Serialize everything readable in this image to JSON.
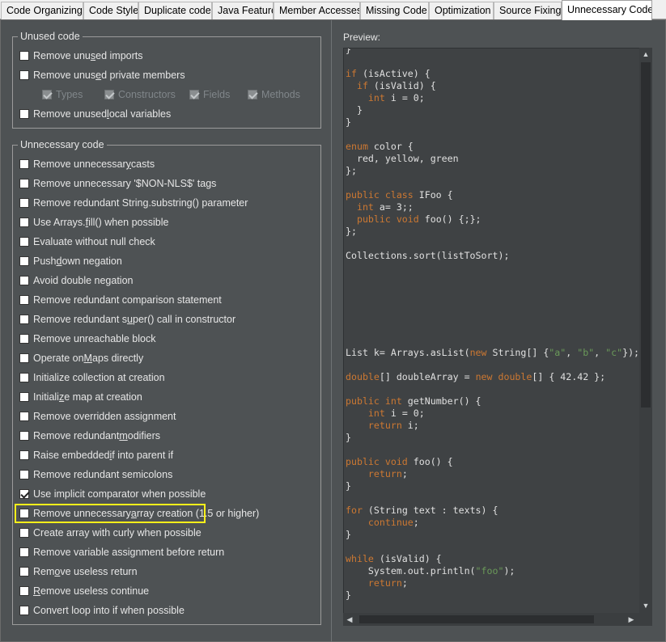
{
  "tabs": [
    {
      "label": "Code Organizing",
      "active": false
    },
    {
      "label": "Code Style",
      "active": false
    },
    {
      "label": "Duplicate code",
      "active": false
    },
    {
      "label": "Java Feature",
      "active": false
    },
    {
      "label": "Member Accesses",
      "active": false
    },
    {
      "label": "Missing Code",
      "active": false
    },
    {
      "label": "Optimization",
      "active": false
    },
    {
      "label": "Source Fixing",
      "active": false
    },
    {
      "label": "Unnecessary Code",
      "active": true
    }
  ],
  "unused_group": {
    "title": "Unused code",
    "imports": {
      "pre": "Remove unu",
      "u": "s",
      "post": "ed imports",
      "checked": false
    },
    "private_members": {
      "pre": "Remove unus",
      "u": "e",
      "post": "d private members",
      "checked": false
    },
    "sub": [
      {
        "label": "Types",
        "checked": true
      },
      {
        "label": "Constructors",
        "checked": true
      },
      {
        "label": "Fields",
        "checked": true
      },
      {
        "label": "Methods",
        "checked": true
      }
    ],
    "local_vars": {
      "pre": "Remove unused ",
      "u": "l",
      "post": "ocal variables",
      "checked": false
    }
  },
  "unnecessary_group": {
    "title": "Unnecessary code",
    "items": [
      {
        "pre": "Remove unnecessar",
        "u": "y",
        "post": " casts",
        "checked": false
      },
      {
        "pre": "Remove unnecessary '$NON-NLS$' tags",
        "u": "",
        "post": "",
        "checked": false
      },
      {
        "pre": "Remove redundant String.substring() parameter",
        "u": "",
        "post": "",
        "checked": false
      },
      {
        "pre": "Use Arrays.",
        "u": "f",
        "post": "ill() when possible",
        "checked": false
      },
      {
        "pre": "Evaluate without null check",
        "u": "",
        "post": "",
        "checked": false
      },
      {
        "pre": "Push ",
        "u": "d",
        "post": "own negation",
        "checked": false
      },
      {
        "pre": "Avoid double negation",
        "u": "",
        "post": "",
        "checked": false
      },
      {
        "pre": "Remove redundant comparison statement",
        "u": "",
        "post": "",
        "checked": false
      },
      {
        "pre": "Remove redundant s",
        "u": "u",
        "post": "per() call in constructor",
        "checked": false
      },
      {
        "pre": "Remove unreachable block",
        "u": "",
        "post": "",
        "checked": false
      },
      {
        "pre": "Operate on ",
        "u": "M",
        "post": "aps directly",
        "checked": false
      },
      {
        "pre": "Initialize collection at creation",
        "u": "",
        "post": "",
        "checked": false
      },
      {
        "pre": "Initiali",
        "u": "z",
        "post": "e map at creation",
        "checked": false
      },
      {
        "pre": "Remove overridden assignment",
        "u": "",
        "post": "",
        "checked": false
      },
      {
        "pre": "Remove redundant ",
        "u": "m",
        "post": "odifiers",
        "checked": false
      },
      {
        "pre": "Raise embedded ",
        "u": "i",
        "post": "f into parent if",
        "checked": false
      },
      {
        "pre": "Remove redundant semicolons",
        "u": "",
        "post": "",
        "checked": false
      },
      {
        "pre": "Use implicit comparator when possible",
        "u": "",
        "post": "",
        "checked": true
      },
      {
        "pre": "Remove unnecessary ",
        "u": "a",
        "post": "rray creation (1.5 or higher)",
        "checked": false
      },
      {
        "pre": "Create array with curly when possible",
        "u": "",
        "post": "",
        "checked": false
      },
      {
        "pre": "Remove variable assignment before return",
        "u": "",
        "post": "",
        "checked": false
      },
      {
        "pre": "Rem",
        "u": "o",
        "post": "ve useless return",
        "checked": false
      },
      {
        "pre": "",
        "u": "R",
        "post": "emove useless continue",
        "checked": false
      },
      {
        "pre": "Convert loop into if when possible",
        "u": "",
        "post": "",
        "checked": false
      }
    ]
  },
  "preview": {
    "label": "Preview:",
    "code": [
      [
        [
          "}",
          ""
        ]
      ],
      [
        [
          "",
          ""
        ]
      ],
      [
        [
          "if",
          "kw"
        ],
        [
          " (isActive) {",
          ""
        ]
      ],
      [
        [
          "  ",
          ""
        ],
        [
          "if",
          "kw"
        ],
        [
          " (isValid) {",
          ""
        ]
      ],
      [
        [
          "    ",
          ""
        ],
        [
          "int",
          "kw"
        ],
        [
          " i = 0;",
          ""
        ]
      ],
      [
        [
          "  }",
          ""
        ]
      ],
      [
        [
          "}",
          ""
        ]
      ],
      [
        [
          "",
          ""
        ]
      ],
      [
        [
          "enum",
          "kw"
        ],
        [
          " color {",
          ""
        ]
      ],
      [
        [
          "  red, yellow, green",
          ""
        ]
      ],
      [
        [
          "};",
          ""
        ]
      ],
      [
        [
          "",
          ""
        ]
      ],
      [
        [
          "public class",
          "kw"
        ],
        [
          " IFoo {",
          ""
        ]
      ],
      [
        [
          "  ",
          ""
        ],
        [
          "int",
          "kw"
        ],
        [
          " a= 3;;",
          ""
        ]
      ],
      [
        [
          "  ",
          ""
        ],
        [
          "public void",
          "kw"
        ],
        [
          " foo() {;};",
          ""
        ]
      ],
      [
        [
          "};",
          ""
        ]
      ],
      [
        [
          "",
          ""
        ]
      ],
      [
        [
          "Collections.sort(listToSort);",
          ""
        ]
      ],
      [
        [
          "",
          ""
        ]
      ],
      [
        [
          "",
          ""
        ]
      ],
      [
        [
          "",
          ""
        ]
      ],
      [
        [
          "",
          ""
        ]
      ],
      [
        [
          "",
          ""
        ]
      ],
      [
        [
          "",
          ""
        ]
      ],
      [
        [
          "",
          ""
        ]
      ],
      [
        [
          "List k= Arrays.asList(",
          ""
        ],
        [
          "new",
          "kw"
        ],
        [
          " String[] {",
          ""
        ],
        [
          "\"a\"",
          "str"
        ],
        [
          ", ",
          ""
        ],
        [
          "\"b\"",
          "str"
        ],
        [
          ", ",
          ""
        ],
        [
          "\"c\"",
          "str"
        ],
        [
          "});",
          ""
        ]
      ],
      [
        [
          "",
          ""
        ]
      ],
      [
        [
          "double",
          "kw"
        ],
        [
          "[] doubleArray = ",
          ""
        ],
        [
          "new double",
          "kw"
        ],
        [
          "[] { 42.42 };",
          ""
        ]
      ],
      [
        [
          "",
          ""
        ]
      ],
      [
        [
          "public int",
          "kw"
        ],
        [
          " getNumber() {",
          ""
        ]
      ],
      [
        [
          "    ",
          ""
        ],
        [
          "int",
          "kw"
        ],
        [
          " i = 0;",
          ""
        ]
      ],
      [
        [
          "    ",
          ""
        ],
        [
          "return",
          "kw"
        ],
        [
          " i;",
          ""
        ]
      ],
      [
        [
          "}",
          ""
        ]
      ],
      [
        [
          "",
          ""
        ]
      ],
      [
        [
          "public void",
          "kw"
        ],
        [
          " foo() {",
          ""
        ]
      ],
      [
        [
          "    ",
          ""
        ],
        [
          "return",
          "kw"
        ],
        [
          ";",
          ""
        ]
      ],
      [
        [
          "}",
          ""
        ]
      ],
      [
        [
          "",
          ""
        ]
      ],
      [
        [
          "for",
          "kw"
        ],
        [
          " (String text : texts) {",
          ""
        ]
      ],
      [
        [
          "    ",
          ""
        ],
        [
          "continue",
          "kw"
        ],
        [
          ";",
          ""
        ]
      ],
      [
        [
          "}",
          ""
        ]
      ],
      [
        [
          "",
          ""
        ]
      ],
      [
        [
          "while",
          "kw"
        ],
        [
          " (isValid) {",
          ""
        ]
      ],
      [
        [
          "    System.out.println(",
          ""
        ],
        [
          "\"foo\"",
          "str"
        ],
        [
          ");",
          ""
        ]
      ],
      [
        [
          "    ",
          ""
        ],
        [
          "return",
          "kw"
        ],
        [
          ";",
          ""
        ]
      ],
      [
        [
          "}",
          ""
        ]
      ]
    ]
  },
  "scroll_arrows": {
    "up": "▲",
    "down": "▼",
    "left": "◀",
    "right": "▶"
  },
  "colors": {
    "panel": "#4e5254",
    "preview_bg": "#3f4244",
    "keyword": "#cc7832",
    "string": "#6a9a59",
    "highlight": "#ffef1a"
  }
}
